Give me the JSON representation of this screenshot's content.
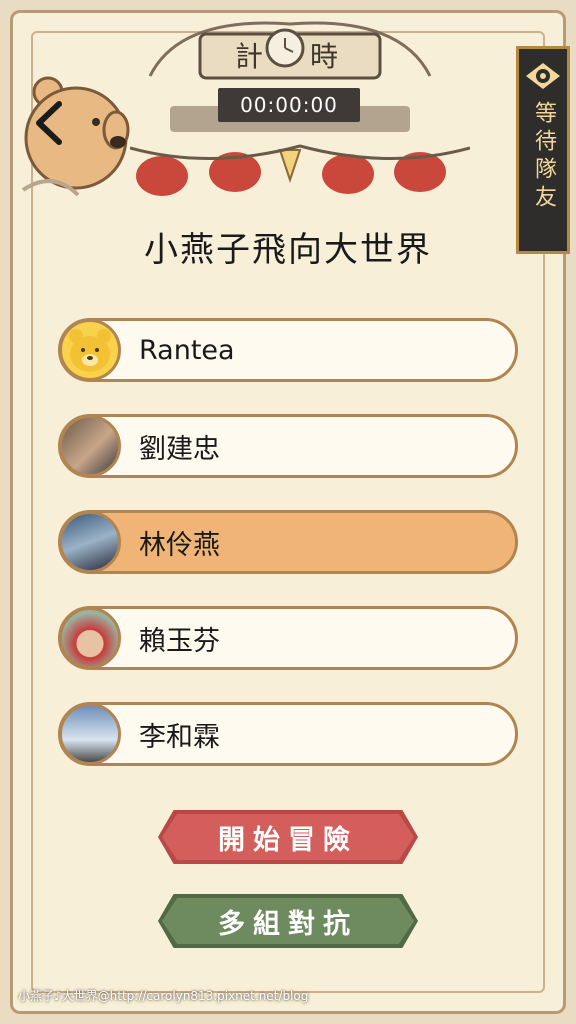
{
  "header": {
    "timer": "00:00:00",
    "banner_left_char": "計",
    "banner_right_char": "時",
    "side_panel_label": "等待隊友"
  },
  "title": "小燕子飛向大世界",
  "players": [
    {
      "name": "Rantea",
      "active": false,
      "avatar": "bear-avatar"
    },
    {
      "name": "劉建忠",
      "active": false,
      "avatar": "photo-avatar"
    },
    {
      "name": "林伶燕",
      "active": true,
      "avatar": "photo-avatar"
    },
    {
      "name": "賴玉芬",
      "active": false,
      "avatar": "photo-avatar"
    },
    {
      "name": "李和霖",
      "active": false,
      "avatar": "photo-avatar"
    }
  ],
  "buttons": {
    "start": "開始冒險",
    "versus": "多組對抗"
  },
  "watermark": "小燕子♪大世界@http://carolyn813.pixnet.net/blog",
  "colors": {
    "background": "#f8efd9",
    "active_row": "#f0b576",
    "start_button": "#d35e5c",
    "versus_button": "#6e8a5f",
    "timer_bg": "#3f3a37"
  }
}
